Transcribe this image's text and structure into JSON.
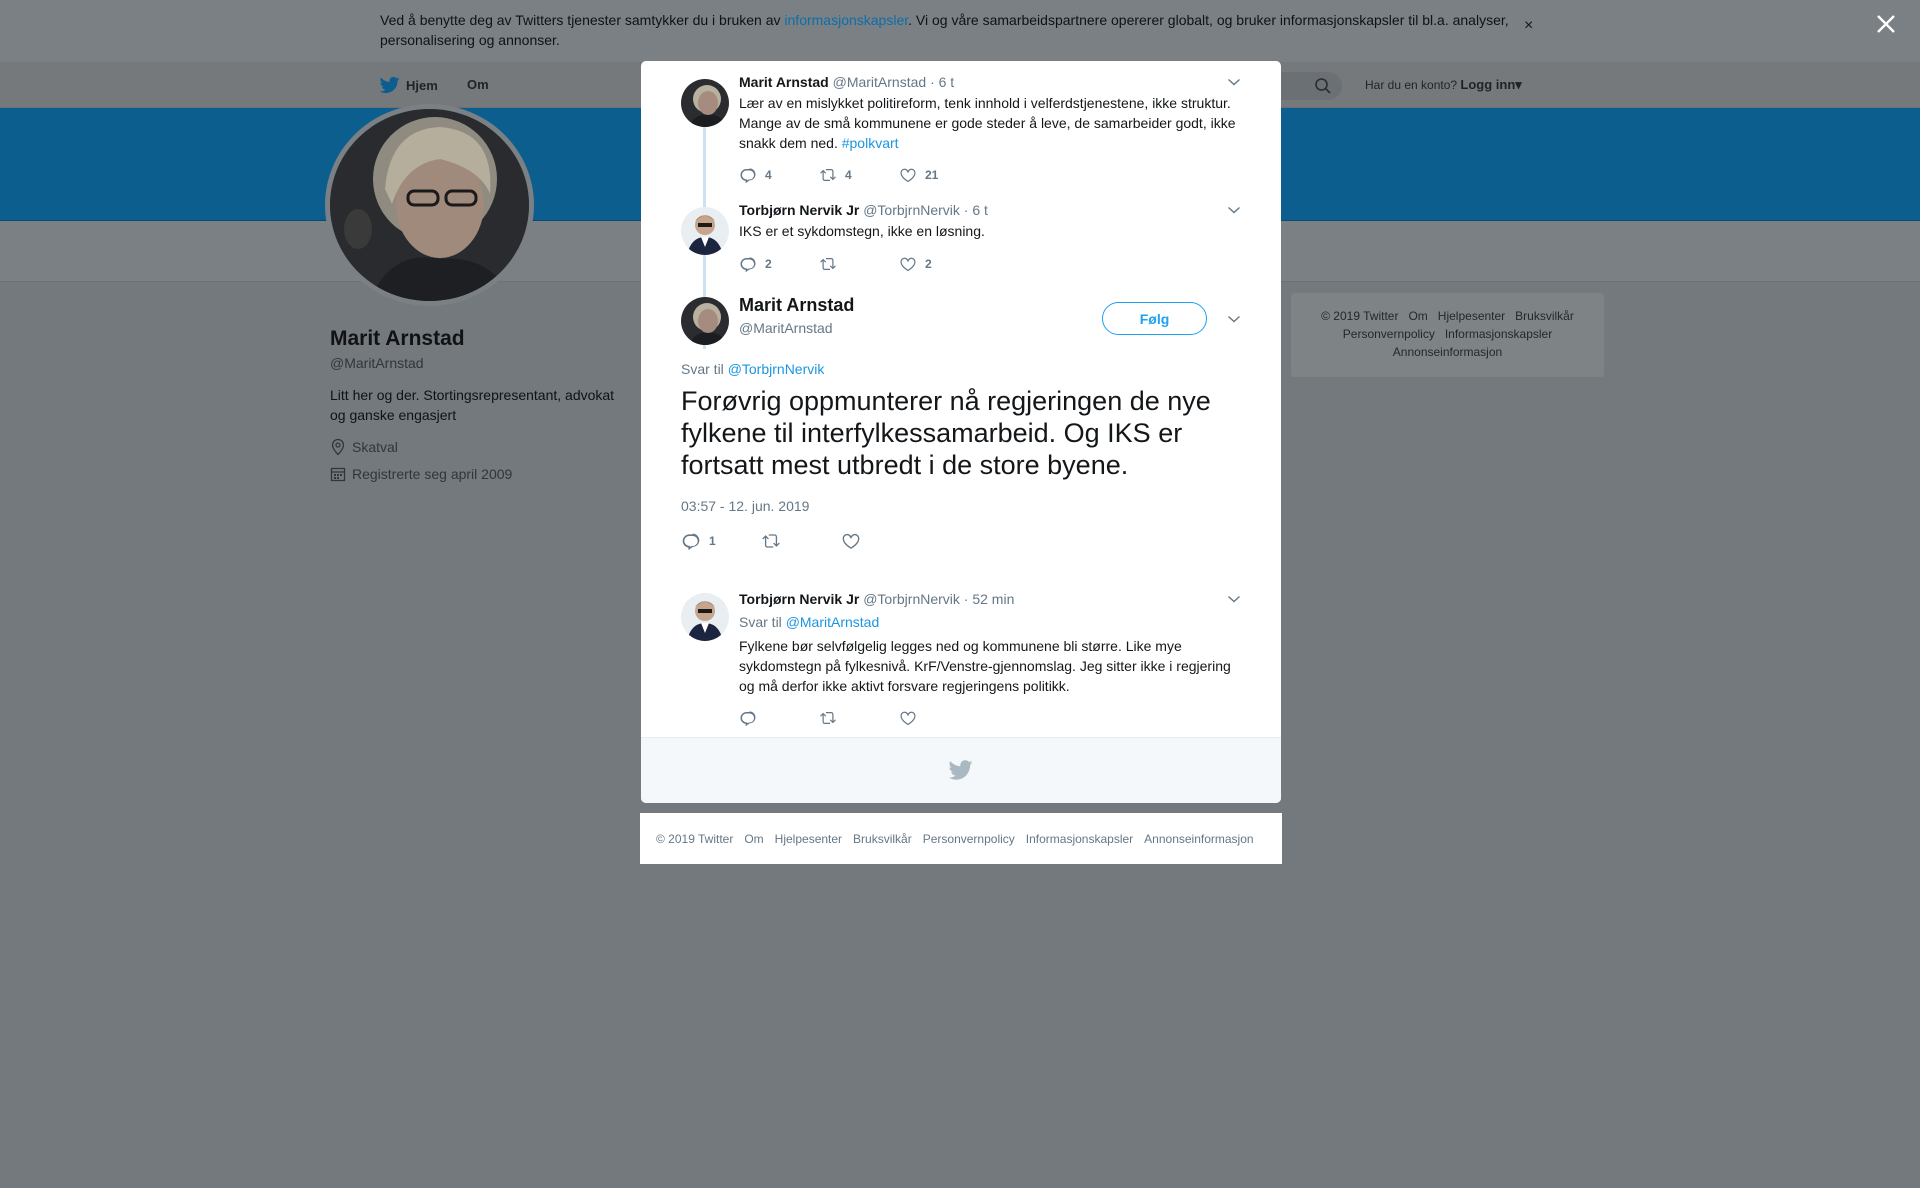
{
  "cookie_banner": {
    "text_before": "Ved å benytte deg av Twitters tjenester samtykker du i bruken av ",
    "link": "informasjonskapsler",
    "text_after": ". Vi og våre samarbeidspartnere opererer globalt, og bruker informasjonskapsler til bl.a. analyser, personalisering og annonser.",
    "close": "×"
  },
  "topnav": {
    "home": "Hjem",
    "about": "Om",
    "account_question": "Har du en konto?",
    "login": "Logg inn"
  },
  "profile": {
    "name": "Marit Arnstad",
    "handle": "@MaritArnstad",
    "bio": "Litt her og der. Stortingsrepresentant, advokat og ganske engasjert",
    "location": "Skatval",
    "joined": "Registrerte seg april 2009"
  },
  "side_footer": {
    "row1": [
      "© 2019 Twitter",
      "Om",
      "Hjelpesenter",
      "Bruksvilkår"
    ],
    "row2": [
      "Personvernpolicy",
      "Informasjonskapsler"
    ],
    "row3": [
      "Annonseinformasjon"
    ]
  },
  "thread": {
    "tweet1": {
      "name": "Marit Arnstad",
      "handle": "@MaritArnstad",
      "time": "· 6 t",
      "text": "Lær av en mislykket politireform, tenk innhold i velferdstjenestene, ikke struktur. Mange av de små kommunene er gode steder å leve, de samarbeider godt, ikke snakk dem ned. ",
      "hashtag": "#polkvart",
      "replies": "4",
      "retweets": "4",
      "likes": "21"
    },
    "tweet2": {
      "name": "Torbjørn Nervik Jr",
      "handle": "@TorbjrnNervik",
      "time": "· 6 t",
      "text": "IKS er et sykdomstegn, ikke en løsning.",
      "replies": "2",
      "retweets": "",
      "likes": "2"
    },
    "main": {
      "name": "Marit Arnstad",
      "handle": "@MaritArnstad",
      "follow": "Følg",
      "reply_prefix": "Svar til",
      "reply_to": "@TorbjrnNervik",
      "text": "Forøvrig oppmunterer nå regjeringen de nye fylkene til interfylkessamarbeid. Og IKS er fortsatt mest utbredt i de store byene.",
      "timestamp": "03:57 - 12. jun. 2019",
      "replies": "1",
      "retweets": "",
      "likes": ""
    },
    "reply": {
      "name": "Torbjørn Nervik Jr",
      "handle": "@TorbjrnNervik",
      "time": "· 52 min",
      "reply_prefix": "Svar til",
      "reply_to": "@MaritArnstad",
      "text": "Fylkene bør selvfølgelig legges ned og kommunene bli større. Like mye sykdomstegn på fylkesnivå. KrF/Venstre-gjennomslag. Jeg sitter ikke i regjering og må derfor ikke aktivt forsvare regjeringens politikk.",
      "replies": "",
      "retweets": "",
      "likes": ""
    }
  },
  "bottom_footer": [
    "© 2019 Twitter",
    "Om",
    "Hjelpesenter",
    "Bruksvilkår",
    "Personvernpolicy",
    "Informasjonskapsler",
    "Annonseinformasjon"
  ],
  "icons": {
    "reply": "reply-icon",
    "retweet": "retweet-icon",
    "like": "heart-icon",
    "brand": "twitter-bird-icon"
  },
  "colors": {
    "accent": "#1da1f2",
    "link": "#1b95e0",
    "overlay": "#74797d"
  }
}
